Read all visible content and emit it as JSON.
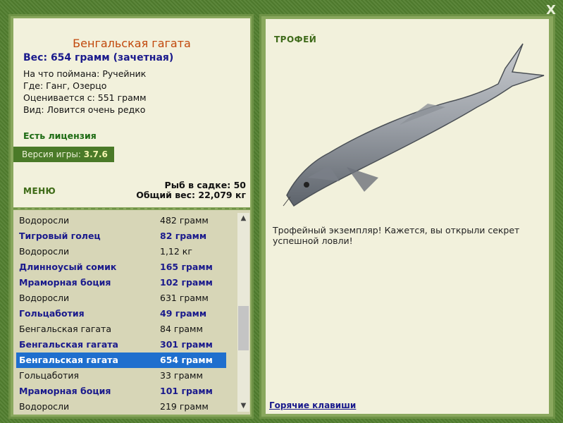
{
  "close_label": "X",
  "fish": {
    "name": "Бенгальская гагата",
    "weight": "Вес: 654 грамм (зачетная)",
    "bait": "На что поймана: Ручейник",
    "location": "Где: Ганг, Озерцо",
    "valued": "Оценивается с: 551 грамм",
    "rarity": "Вид: Ловится очень редко"
  },
  "license": "Есть лицензия",
  "version": {
    "label": "Версия игры: ",
    "value": "3.7.6"
  },
  "menu_label": "МЕНЮ",
  "keep": {
    "count": "Рыб в садке: 50",
    "total": "Общий вес: 22,079 кг"
  },
  "catch_list": [
    {
      "name": "Водоросли",
      "weight": "482 грамм",
      "style": "normal"
    },
    {
      "name": "Тигровый голец",
      "weight": "82 грамм",
      "style": "bold"
    },
    {
      "name": "Водоросли",
      "weight": "1,12 кг",
      "style": "normal"
    },
    {
      "name": "Длинноусый сомик",
      "weight": "165 грамм",
      "style": "bold"
    },
    {
      "name": "Мраморная боция",
      "weight": "102 грамм",
      "style": "bold"
    },
    {
      "name": "Водоросли",
      "weight": "631 грамм",
      "style": "normal"
    },
    {
      "name": "Гольцаботия",
      "weight": "49 грамм",
      "style": "bold"
    },
    {
      "name": "Бенгальская гагата",
      "weight": "84 грамм",
      "style": "normal"
    },
    {
      "name": "Бенгальская гагата",
      "weight": "301 грамм",
      "style": "bold"
    },
    {
      "name": "Бенгальская гагата",
      "weight": "654 грамм",
      "style": "sel"
    },
    {
      "name": "Гольцаботия",
      "weight": "33 грамм",
      "style": "normal"
    },
    {
      "name": "Мраморная боция",
      "weight": "101 грамм",
      "style": "bold"
    },
    {
      "name": "Водоросли",
      "weight": "219 грамм",
      "style": "normal"
    }
  ],
  "trophy": {
    "label": "ТРОФЕЙ",
    "text": "Трофейный экземпляр! Кажется, вы открыли секрет успешной ловли!"
  },
  "hotkeys_label": "Горячие клавиши",
  "colors": {
    "frame": "#527f2f",
    "panel": "#f2f1dc",
    "list_bg": "#d7d6b7",
    "selected": "#1f6fce",
    "fish_name": "#c1480c",
    "bold_text": "#1a1a8c"
  }
}
